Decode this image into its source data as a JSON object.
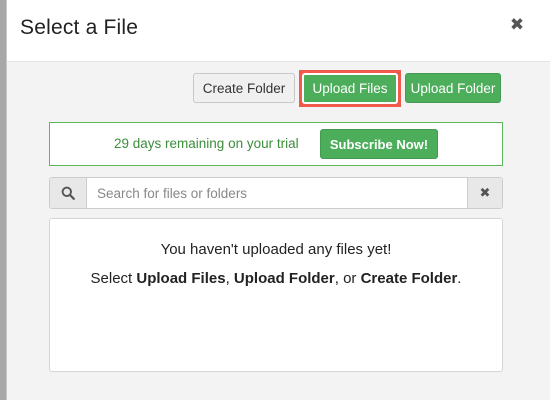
{
  "dialog": {
    "title": "Select a File",
    "close_glyph": "✖"
  },
  "toolbar": {
    "create_folder_label": "Create Folder",
    "upload_files_label": "Upload Files",
    "upload_folder_label": "Upload Folder"
  },
  "trial": {
    "message": "29 days remaining on your trial",
    "subscribe_label": "Subscribe Now!"
  },
  "search": {
    "placeholder": "Search for files or folders",
    "value": "",
    "clear_glyph": "✖",
    "icon": "search-icon"
  },
  "empty_state": {
    "line1": "You haven't uploaded any files yet!",
    "prefix": "Select ",
    "upload_files": "Upload Files",
    "sep1": ", ",
    "upload_folder": "Upload Folder",
    "sep2": ", or ",
    "create_folder": "Create Folder",
    "suffix": "."
  },
  "colors": {
    "success": "#4cae5b",
    "highlight": "#f05a4a",
    "trial_text": "#3c8d3c"
  }
}
